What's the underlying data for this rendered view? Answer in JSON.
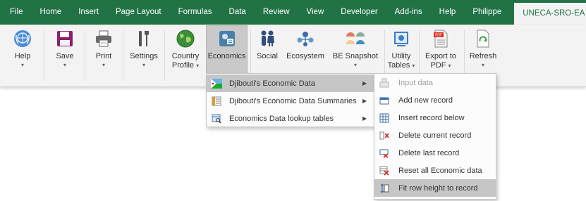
{
  "tabs": [
    "File",
    "Home",
    "Insert",
    "Page Layout",
    "Formulas",
    "Data",
    "Review",
    "View",
    "Developer",
    "Add-ins",
    "Help",
    "Philippe",
    "UNECA-SRO-EA"
  ],
  "active_tab": "UNECA-SRO-EA",
  "ribbon": {
    "help": {
      "label": "Help",
      "icon": "un-logo-icon"
    },
    "save": {
      "label": "Save",
      "icon": "floppy-disk-icon"
    },
    "print": {
      "label": "Print",
      "icon": "printer-icon"
    },
    "settings": {
      "label": "Settings",
      "icon": "tools-icon"
    },
    "country_profile": {
      "label1": "Country",
      "label2": "Profile",
      "icon": "globe-icon"
    },
    "economics": {
      "label": "Economics",
      "icon": "economics-icon"
    },
    "social": {
      "label": "Social",
      "icon": "people-icon"
    },
    "ecosystem": {
      "label": "Ecosystem",
      "icon": "ecosystem-icon"
    },
    "be_snapshot": {
      "label": "BE Snapshot",
      "icon": "gauges-icon"
    },
    "utility_tables": {
      "label1": "Utility",
      "label2": "Tables",
      "icon": "utility-table-icon"
    },
    "export_pdf": {
      "label1": "Export to",
      "label2": "PDF",
      "icon": "pdf-icon"
    },
    "refresh": {
      "label": "Refresh",
      "icon": "refresh-icon"
    }
  },
  "economics_menu": [
    {
      "label": "Djibouti's Economic Data",
      "icon": "flag-icon",
      "submenu": true,
      "highlighted": true
    },
    {
      "label": "Djibouti's Economic Data Summaries",
      "icon": "summary-icon",
      "submenu": true,
      "highlighted": false
    },
    {
      "label": "Economics Data lookup tables",
      "icon": "lookup-icon",
      "submenu": true,
      "highlighted": false
    }
  ],
  "submenu": [
    {
      "label": "Input data",
      "icon": "input-data-icon",
      "disabled": true
    },
    {
      "label": "Add new record",
      "icon": "add-record-icon",
      "disabled": false
    },
    {
      "label": "Insert record below",
      "icon": "insert-record-icon",
      "disabled": false
    },
    {
      "label": "Delete current record",
      "icon": "delete-current-icon",
      "disabled": false
    },
    {
      "label": "Delete last record",
      "icon": "delete-last-icon",
      "disabled": false
    },
    {
      "label": "Reset all Economic data",
      "icon": "reset-icon",
      "disabled": false
    },
    {
      "label": "Fit row height to record",
      "icon": "fit-row-height-icon",
      "disabled": false,
      "highlighted": true
    }
  ]
}
